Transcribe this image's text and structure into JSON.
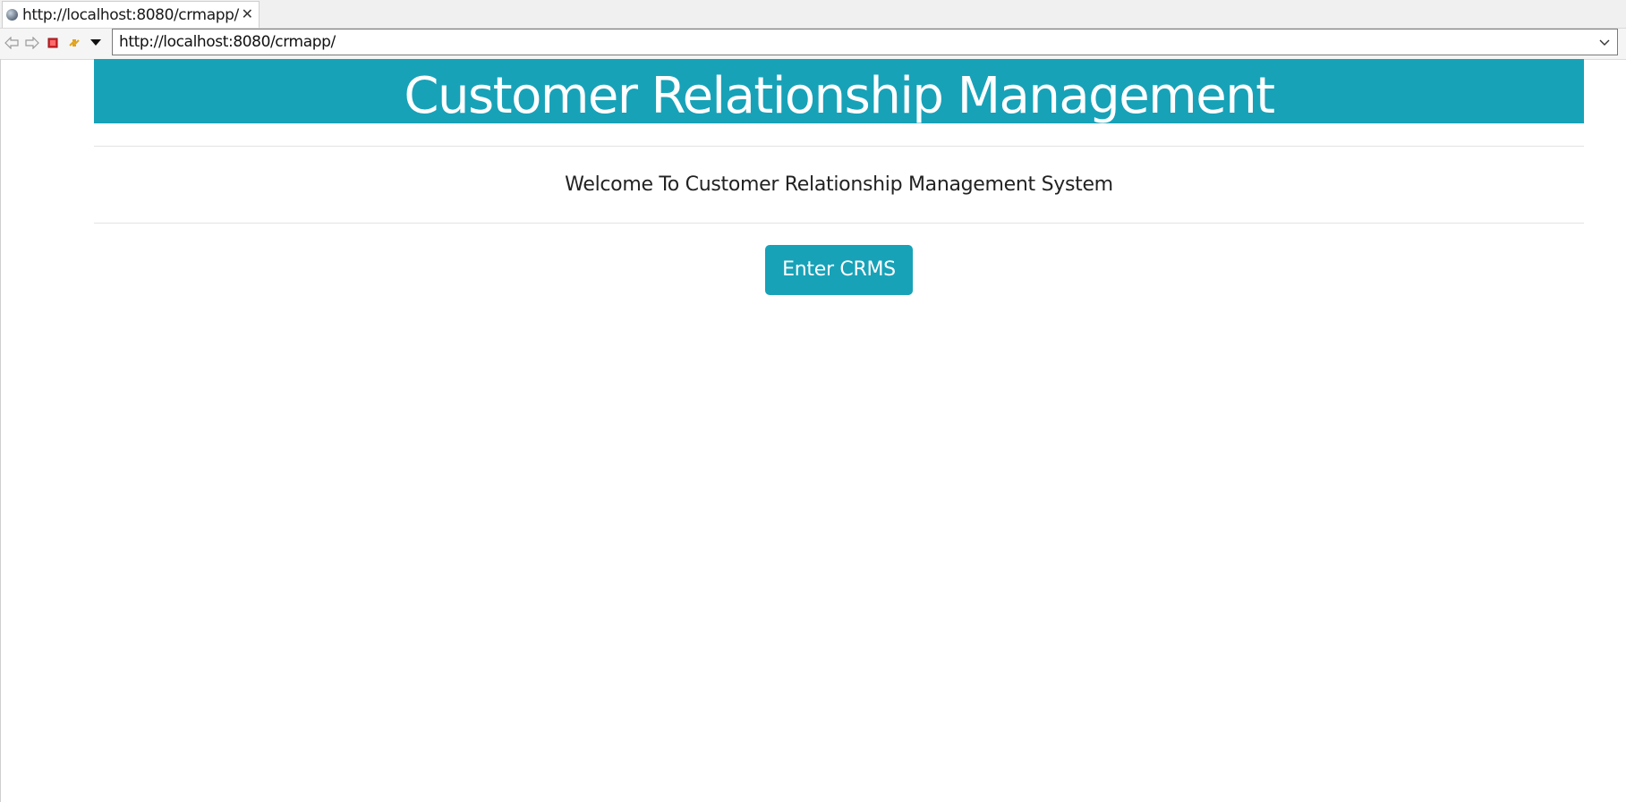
{
  "browser": {
    "tab": {
      "title": "http://localhost:8080/crmapp/",
      "favicon": "globe-icon",
      "close_icon": "close-icon"
    },
    "toolbar": {
      "back_icon": "back-arrow-icon",
      "forward_icon": "forward-arrow-icon",
      "stop_icon": "stop-icon",
      "refresh_icon": "refresh-icon",
      "menu_icon": "dropdown-triangle-icon"
    },
    "url": {
      "value": "http://localhost:8080/crmapp/",
      "dropdown_icon": "chevron-down-icon"
    }
  },
  "page": {
    "banner_title": "Customer Relationship Management",
    "welcome_text": "Welcome To Customer Relationship Management System",
    "enter_button_label": "Enter CRMS"
  },
  "colors": {
    "accent": "#17a2b8",
    "background": "#ffffff",
    "text": "#222222"
  }
}
